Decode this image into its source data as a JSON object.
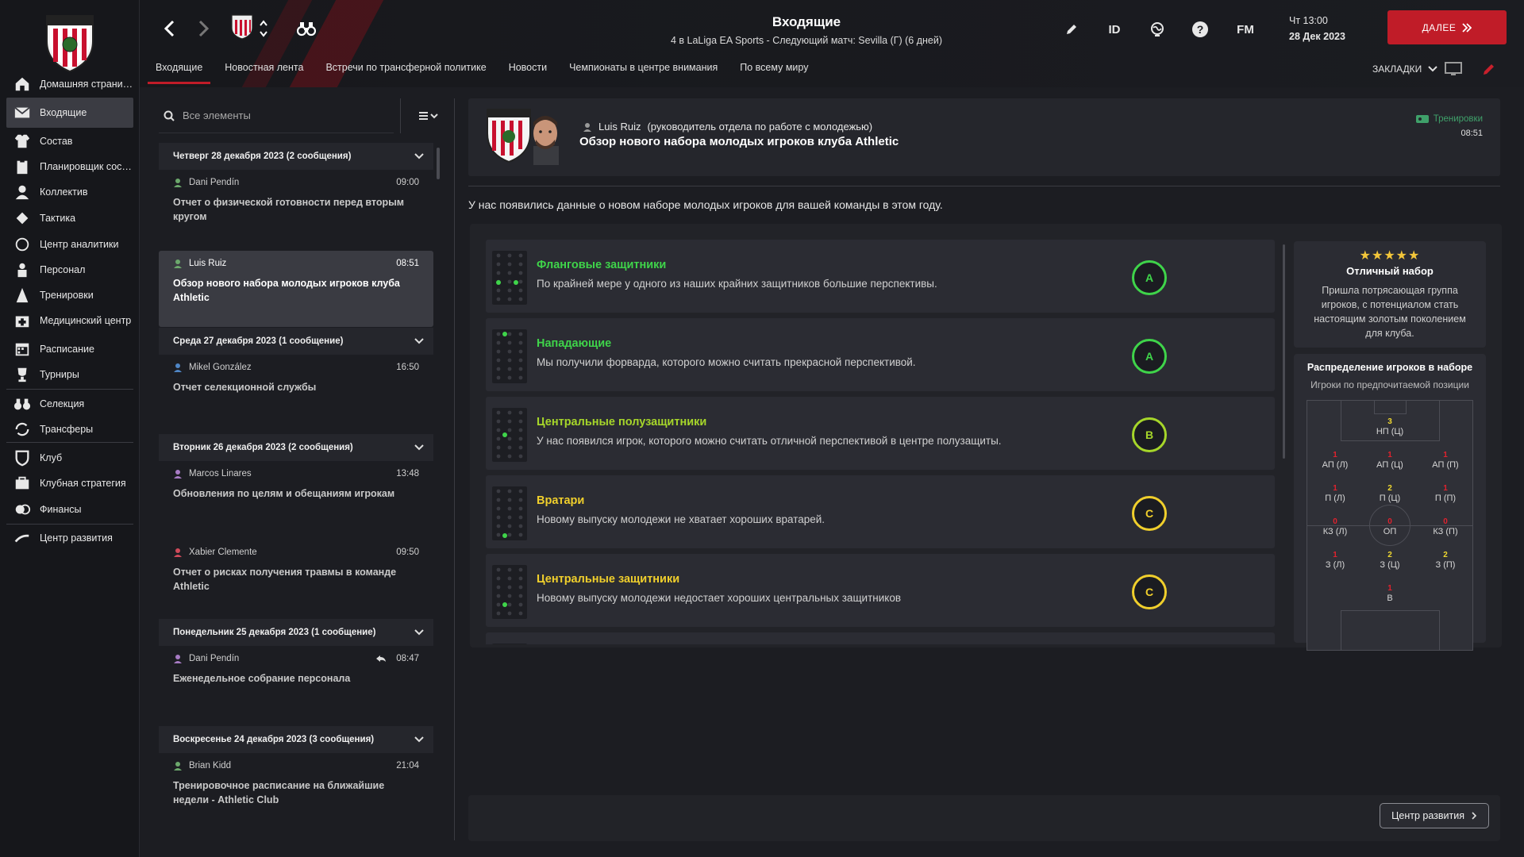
{
  "sidebar": {
    "items": [
      {
        "label": "Домашняя страница",
        "icon": "home-icon"
      },
      {
        "label": "Входящие",
        "icon": "mail-icon",
        "active": true
      },
      {
        "label": "Состав",
        "icon": "shirt-icon"
      },
      {
        "label": "Планировщик сост...",
        "icon": "clipboard-icon"
      },
      {
        "label": "Коллектив",
        "icon": "team-icon"
      },
      {
        "label": "Тактика",
        "icon": "tactics-icon"
      },
      {
        "label": "Центр аналитики",
        "icon": "analytics-icon"
      },
      {
        "label": "Персонал",
        "icon": "staff-icon"
      },
      {
        "label": "Тренировки",
        "icon": "training-icon"
      },
      {
        "label": "Медицинский центр",
        "icon": "medical-icon"
      },
      {
        "label": "Расписание",
        "icon": "calendar-icon"
      },
      {
        "label": "Турниры",
        "icon": "trophy-icon"
      },
      {
        "label": "Селекция",
        "icon": "binoculars-icon"
      },
      {
        "label": "Трансферы",
        "icon": "transfer-icon"
      },
      {
        "label": "Клуб",
        "icon": "shield-icon"
      },
      {
        "label": "Клубная стратегия",
        "icon": "strategy-icon"
      },
      {
        "label": "Финансы",
        "icon": "finance-icon"
      },
      {
        "label": "Центр развития",
        "icon": "development-icon"
      }
    ]
  },
  "header": {
    "title": "Входящие",
    "subtitle": "4 в LaLiga EA Sports - Следующий матч: Sevilla (Г) (6 дней)",
    "time": "Чт 13:00",
    "date": "28 Дек 2023",
    "next_label": "ДАЛЕЕ",
    "id_label": "ID",
    "fm_label": "FM",
    "bookmarks_label": "ЗАКЛАДКИ",
    "tabs": [
      "Входящие",
      "Новостная лента",
      "Встречи по трансферной политике",
      "Новости",
      "Чемпионаты в центре внимания",
      "По всему миру"
    ]
  },
  "inbox": {
    "search_placeholder": "Все элементы",
    "groups": [
      {
        "header": "Четверг 28 декабря 2023 (2 сообщения)"
      },
      {
        "header": "Среда 27 декабря 2023 (1 сообщение)"
      },
      {
        "header": "Вторник 26 декабря 2023 (2 сообщения)"
      },
      {
        "header": "Понедельник 25 декабря 2023 (1 сообщение)"
      },
      {
        "header": "Воскресенье 24 декабря 2023 (3 сообщения)"
      }
    ],
    "messages": [
      {
        "from": "Dani Pendín",
        "time": "09:00",
        "subject": "Отчет о физической готовности перед вторым кругом",
        "color": "#6ca86c"
      },
      {
        "from": "Luis Ruiz",
        "time": "08:51",
        "subject": "Обзор нового набора молодых игроков клуба Athletic",
        "color": "#6ca86c",
        "selected": true
      },
      {
        "from": "Mikel González",
        "time": "16:50",
        "subject": "Отчет селекционной службы",
        "color": "#4f86c6"
      },
      {
        "from": "Marcos Linares",
        "time": "13:48",
        "subject": "Обновления по целям и обещаниям игрокам",
        "color": "#a77bc4"
      },
      {
        "from": "Xabier Clemente",
        "time": "09:50",
        "subject": "Отчет о рисках получения травмы в команде Athletic",
        "color": "#d04a5a"
      },
      {
        "from": "Dani Pendín",
        "time": "08:47",
        "subject": "Еженедельное собрание персонала",
        "color": "#a77bc4"
      },
      {
        "from": "Brian Kidd",
        "time": "21:04",
        "subject": "Тренировочное расписание на ближайшие недели - Athletic Club",
        "color": "#6ca86c"
      }
    ]
  },
  "message": {
    "sender": "Luis Ruiz",
    "sender_role": "(руководитель отдела по работе с молодежью)",
    "title": "Обзор нового набора молодых игроков клуба Athletic",
    "tag": "Тренировки",
    "tag_time": "08:51",
    "intro": "У нас появились данные о новом наборе молодых игроков для вашей команды в этом году.",
    "positions": [
      {
        "name": "Фланговые защитники",
        "desc": "По крайней мере у одного из наших крайних защитников большие перспективы.",
        "grade": "A",
        "color": "#3fd44a"
      },
      {
        "name": "Нападающие",
        "desc": "Мы получили форварда, которого можно считать прекрасной перспективой.",
        "grade": "A",
        "color": "#3fd44a"
      },
      {
        "name": "Центральные полузащитники",
        "desc": "У нас появился игрок, которого можно считать отличной перспективой в центре полузащиты.",
        "grade": "B",
        "color": "#a6d62a"
      },
      {
        "name": "Вратари",
        "desc": "Новому выпуску молодежи не хватает хороших вратарей.",
        "grade": "C",
        "color": "#f0cf2c"
      },
      {
        "name": "Центральные защитники",
        "desc": "Новому выпуску молодежи недостает хороших центральных защитников",
        "grade": "C",
        "color": "#f0cf2c"
      }
    ],
    "summary": {
      "stars": "★★★★★",
      "rating_stars": 5,
      "title": "Отличный набор",
      "desc": "Пришла потрясающая группа игроков, с потенциалом стать настоящим золотым поколением для клуба."
    },
    "distribution": {
      "title": "Распределение игроков в наборе",
      "subtitle": "Игроки по предпочитаемой позиции",
      "cells": [
        {
          "n": "3",
          "pos": "НП (Ц)"
        },
        {
          "n": "1",
          "pos": "АП (Л)"
        },
        {
          "n": "1",
          "pos": "АП (Ц)"
        },
        {
          "n": "1",
          "pos": "АП (П)"
        },
        {
          "n": "1",
          "pos": "П (Л)"
        },
        {
          "n": "2",
          "pos": "П (Ц)"
        },
        {
          "n": "1",
          "pos": "П (П)"
        },
        {
          "n": "0",
          "pos": "КЗ (Л)"
        },
        {
          "n": "0",
          "pos": "ОП"
        },
        {
          "n": "0",
          "pos": "КЗ (П)"
        },
        {
          "n": "1",
          "pos": "З (Л)"
        },
        {
          "n": "2",
          "pos": "З (Ц)"
        },
        {
          "n": "2",
          "pos": "З (П)"
        },
        {
          "n": "1",
          "pos": "В"
        }
      ]
    },
    "dev_center_label": "Центр развития"
  }
}
